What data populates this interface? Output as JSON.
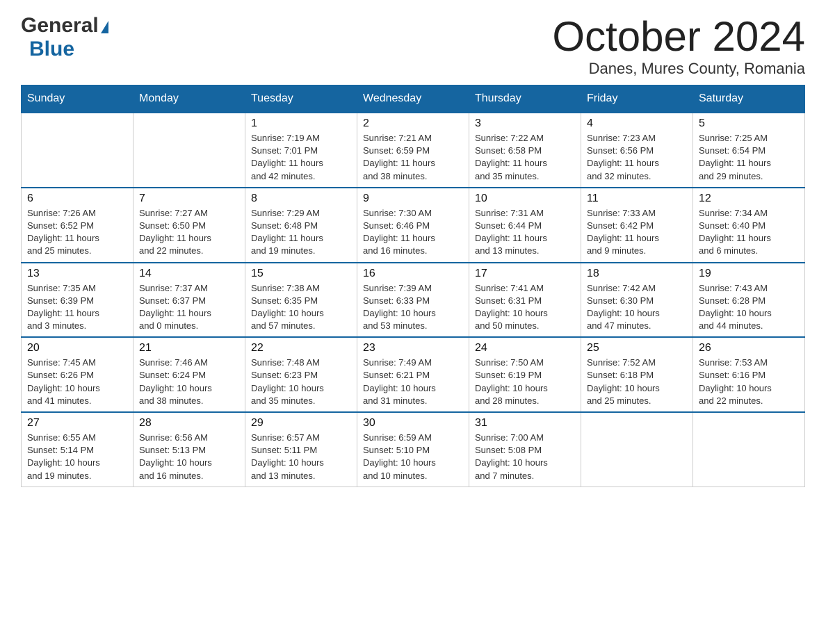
{
  "header": {
    "logo": {
      "general": "General",
      "blue": "Blue"
    },
    "title": "October 2024",
    "location": "Danes, Mures County, Romania"
  },
  "columns": [
    "Sunday",
    "Monday",
    "Tuesday",
    "Wednesday",
    "Thursday",
    "Friday",
    "Saturday"
  ],
  "weeks": [
    [
      {
        "day": "",
        "info": ""
      },
      {
        "day": "",
        "info": ""
      },
      {
        "day": "1",
        "info": "Sunrise: 7:19 AM\nSunset: 7:01 PM\nDaylight: 11 hours\nand 42 minutes."
      },
      {
        "day": "2",
        "info": "Sunrise: 7:21 AM\nSunset: 6:59 PM\nDaylight: 11 hours\nand 38 minutes."
      },
      {
        "day": "3",
        "info": "Sunrise: 7:22 AM\nSunset: 6:58 PM\nDaylight: 11 hours\nand 35 minutes."
      },
      {
        "day": "4",
        "info": "Sunrise: 7:23 AM\nSunset: 6:56 PM\nDaylight: 11 hours\nand 32 minutes."
      },
      {
        "day": "5",
        "info": "Sunrise: 7:25 AM\nSunset: 6:54 PM\nDaylight: 11 hours\nand 29 minutes."
      }
    ],
    [
      {
        "day": "6",
        "info": "Sunrise: 7:26 AM\nSunset: 6:52 PM\nDaylight: 11 hours\nand 25 minutes."
      },
      {
        "day": "7",
        "info": "Sunrise: 7:27 AM\nSunset: 6:50 PM\nDaylight: 11 hours\nand 22 minutes."
      },
      {
        "day": "8",
        "info": "Sunrise: 7:29 AM\nSunset: 6:48 PM\nDaylight: 11 hours\nand 19 minutes."
      },
      {
        "day": "9",
        "info": "Sunrise: 7:30 AM\nSunset: 6:46 PM\nDaylight: 11 hours\nand 16 minutes."
      },
      {
        "day": "10",
        "info": "Sunrise: 7:31 AM\nSunset: 6:44 PM\nDaylight: 11 hours\nand 13 minutes."
      },
      {
        "day": "11",
        "info": "Sunrise: 7:33 AM\nSunset: 6:42 PM\nDaylight: 11 hours\nand 9 minutes."
      },
      {
        "day": "12",
        "info": "Sunrise: 7:34 AM\nSunset: 6:40 PM\nDaylight: 11 hours\nand 6 minutes."
      }
    ],
    [
      {
        "day": "13",
        "info": "Sunrise: 7:35 AM\nSunset: 6:39 PM\nDaylight: 11 hours\nand 3 minutes."
      },
      {
        "day": "14",
        "info": "Sunrise: 7:37 AM\nSunset: 6:37 PM\nDaylight: 11 hours\nand 0 minutes."
      },
      {
        "day": "15",
        "info": "Sunrise: 7:38 AM\nSunset: 6:35 PM\nDaylight: 10 hours\nand 57 minutes."
      },
      {
        "day": "16",
        "info": "Sunrise: 7:39 AM\nSunset: 6:33 PM\nDaylight: 10 hours\nand 53 minutes."
      },
      {
        "day": "17",
        "info": "Sunrise: 7:41 AM\nSunset: 6:31 PM\nDaylight: 10 hours\nand 50 minutes."
      },
      {
        "day": "18",
        "info": "Sunrise: 7:42 AM\nSunset: 6:30 PM\nDaylight: 10 hours\nand 47 minutes."
      },
      {
        "day": "19",
        "info": "Sunrise: 7:43 AM\nSunset: 6:28 PM\nDaylight: 10 hours\nand 44 minutes."
      }
    ],
    [
      {
        "day": "20",
        "info": "Sunrise: 7:45 AM\nSunset: 6:26 PM\nDaylight: 10 hours\nand 41 minutes."
      },
      {
        "day": "21",
        "info": "Sunrise: 7:46 AM\nSunset: 6:24 PM\nDaylight: 10 hours\nand 38 minutes."
      },
      {
        "day": "22",
        "info": "Sunrise: 7:48 AM\nSunset: 6:23 PM\nDaylight: 10 hours\nand 35 minutes."
      },
      {
        "day": "23",
        "info": "Sunrise: 7:49 AM\nSunset: 6:21 PM\nDaylight: 10 hours\nand 31 minutes."
      },
      {
        "day": "24",
        "info": "Sunrise: 7:50 AM\nSunset: 6:19 PM\nDaylight: 10 hours\nand 28 minutes."
      },
      {
        "day": "25",
        "info": "Sunrise: 7:52 AM\nSunset: 6:18 PM\nDaylight: 10 hours\nand 25 minutes."
      },
      {
        "day": "26",
        "info": "Sunrise: 7:53 AM\nSunset: 6:16 PM\nDaylight: 10 hours\nand 22 minutes."
      }
    ],
    [
      {
        "day": "27",
        "info": "Sunrise: 6:55 AM\nSunset: 5:14 PM\nDaylight: 10 hours\nand 19 minutes."
      },
      {
        "day": "28",
        "info": "Sunrise: 6:56 AM\nSunset: 5:13 PM\nDaylight: 10 hours\nand 16 minutes."
      },
      {
        "day": "29",
        "info": "Sunrise: 6:57 AM\nSunset: 5:11 PM\nDaylight: 10 hours\nand 13 minutes."
      },
      {
        "day": "30",
        "info": "Sunrise: 6:59 AM\nSunset: 5:10 PM\nDaylight: 10 hours\nand 10 minutes."
      },
      {
        "day": "31",
        "info": "Sunrise: 7:00 AM\nSunset: 5:08 PM\nDaylight: 10 hours\nand 7 minutes."
      },
      {
        "day": "",
        "info": ""
      },
      {
        "day": "",
        "info": ""
      }
    ]
  ]
}
